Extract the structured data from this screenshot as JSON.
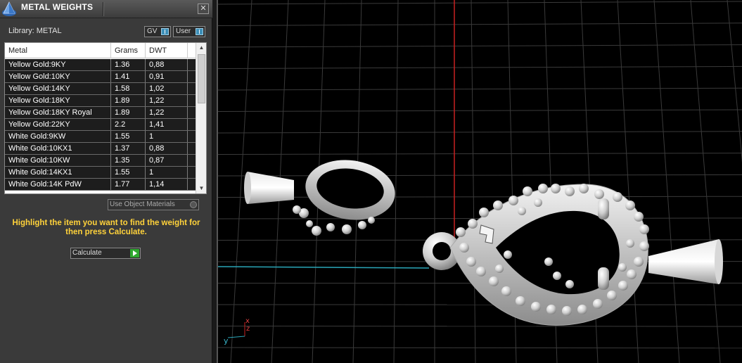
{
  "window": {
    "title": "METAL WEIGHTS",
    "close_glyph": "✕"
  },
  "library": {
    "label": "Library: METAL",
    "gv_label": "GV",
    "user_label": "User"
  },
  "table": {
    "columns": [
      "Metal",
      "Grams",
      "DWT"
    ],
    "rows": [
      {
        "metal": "Yellow Gold:9KY",
        "grams": "1.36",
        "dwt": "0,88"
      },
      {
        "metal": "Yellow Gold:10KY",
        "grams": "1.41",
        "dwt": "0,91"
      },
      {
        "metal": "Yellow Gold:14KY",
        "grams": "1.58",
        "dwt": "1,02"
      },
      {
        "metal": "Yellow Gold:18KY",
        "grams": "1.89",
        "dwt": "1,22"
      },
      {
        "metal": "Yellow Gold:18KY Royal",
        "grams": "1.89",
        "dwt": "1,22"
      },
      {
        "metal": "Yellow Gold:22KY",
        "grams": "2.2",
        "dwt": "1,41"
      },
      {
        "metal": "White Gold:9KW",
        "grams": "1.55",
        "dwt": "1"
      },
      {
        "metal": "White Gold:10KX1",
        "grams": "1.37",
        "dwt": "0,88"
      },
      {
        "metal": "White Gold:10KW",
        "grams": "1.35",
        "dwt": "0,87"
      },
      {
        "metal": "White Gold:14KX1",
        "grams": "1.55",
        "dwt": "1"
      },
      {
        "metal": "White Gold:14K PdW",
        "grams": "1.77",
        "dwt": "1,14"
      }
    ]
  },
  "use_object_materials": "Use Object Materials",
  "hint": "Highlight the item you want to find the weight for then press Calculate.",
  "calculate_label": "Calculate",
  "axis": {
    "x": "x",
    "y": "y",
    "z": "z"
  },
  "colors": {
    "grid": "#3a3a3a",
    "axis_red": "#c82020",
    "axis_cyan": "#2aa6b8",
    "hint_yellow": "#ffd23a",
    "accent_blue": "#3d8fb8",
    "play_green": "#2fa82f"
  },
  "icons": {
    "app_logo": "pyramid-logo-icon",
    "close": "close-icon",
    "scroll_up": "chevron-up-icon",
    "scroll_down": "chevron-down-icon",
    "calculate": "play-icon"
  }
}
